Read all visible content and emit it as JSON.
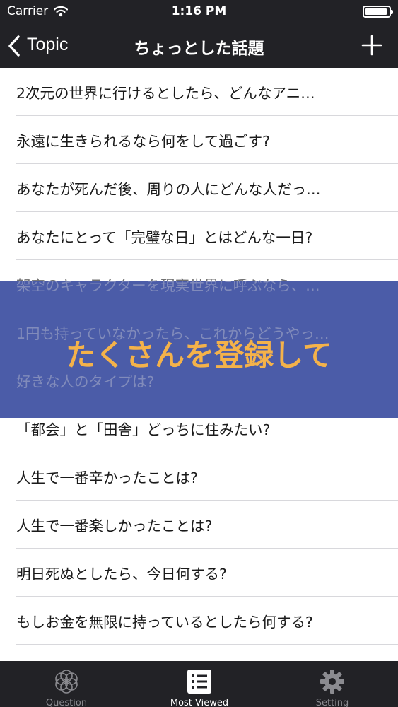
{
  "status_bar": {
    "carrier": "Carrier",
    "time": "1:16 PM"
  },
  "nav": {
    "back_label": "Topic",
    "title": "ちょっとした話題"
  },
  "topics": [
    "2次元の世界に行けるとしたら、どんなアニ…",
    "永遠に生きられるなら何をして過ごす?",
    "あなたが死んだ後、周りの人にどんな人だっ…",
    "あなたにとって「完璧な日」とはどんな一日?",
    "架空のキャラクターを現実世界に呼ぶなら、…",
    "1円も持っていなかったら、これからどうやっ…",
    "好きな人のタイプは?",
    "「都会」と「田舎」どっちに住みたい?",
    "人生で一番辛かったことは?",
    "人生で一番楽しかったことは?",
    "明日死ぬとしたら、今日何する?",
    "もしお金を無限に持っているとしたら何する?"
  ],
  "banner": {
    "text": "たくさんを登録して"
  },
  "tabs": [
    {
      "label": "Question",
      "icon": "flower-icon",
      "active": false
    },
    {
      "label": "Most Viewed",
      "icon": "list-icon",
      "active": true
    },
    {
      "label": "Setting",
      "icon": "gear-icon",
      "active": false
    }
  ],
  "colors": {
    "bar": "#222226",
    "banner": "#374a9e",
    "banner_text": "#f4b24a",
    "inactive_tab": "#8b8b90"
  }
}
